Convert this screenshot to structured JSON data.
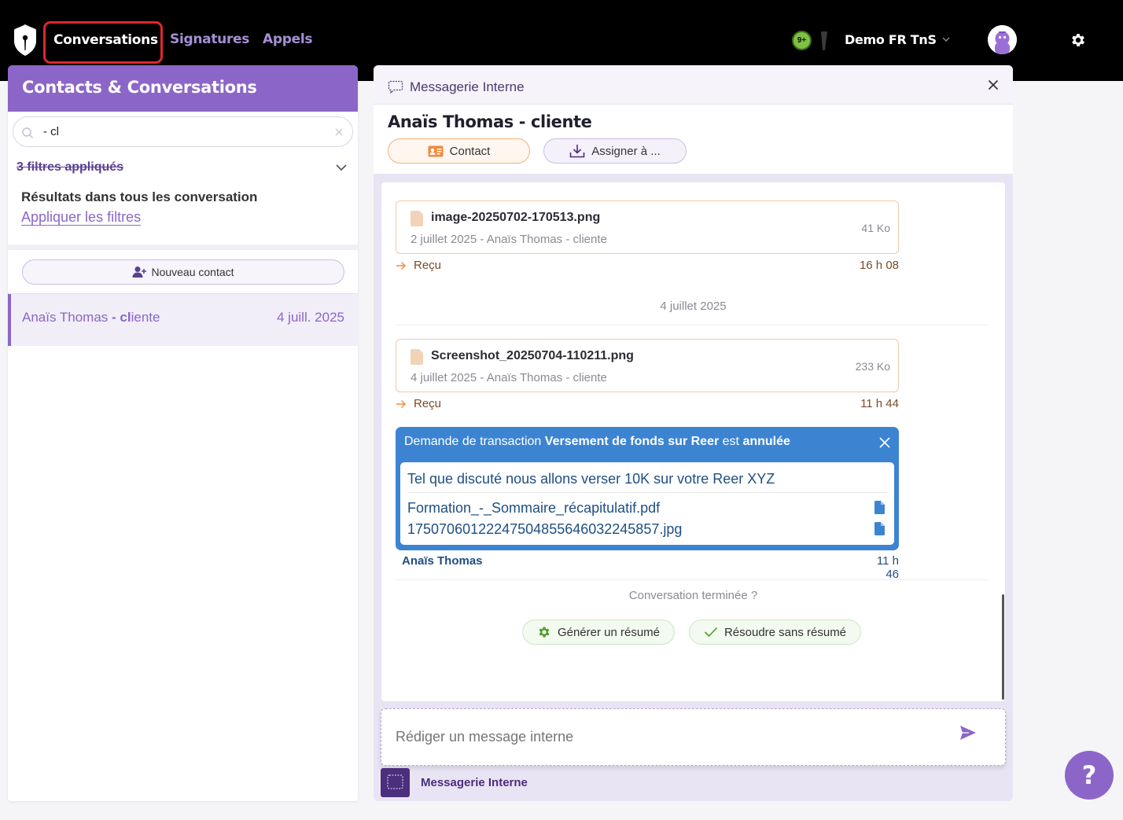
{
  "topbar": {
    "nav": {
      "conversations": "Conversations",
      "signatures": "Signatures",
      "appels": "Appels"
    },
    "notifications_badge": "9+",
    "workspace": "Demo FR TnS"
  },
  "left": {
    "header": "Contacts & Conversations",
    "search": {
      "value": "- cl"
    },
    "filters_label": "3 filtres appliqués",
    "results_title": "Résultats dans tous les conversation",
    "apply_filters": "Appliquer les filtres",
    "new_contact": "Nouveau contact",
    "conversations": [
      {
        "name_prefix": "Anaïs Thomas ",
        "name_match": "- cl",
        "name_suffix": "iente",
        "date": "4 juill. 2025"
      }
    ]
  },
  "right": {
    "top_title": "Messagerie Interne",
    "contact_name": "Anaïs Thomas - cliente",
    "buttons": {
      "contact": "Contact",
      "assign": "Assigner à ..."
    },
    "messages": [
      {
        "file_name": "image-20250702-170513.png",
        "meta": "2 juillet 2025 - Anaïs Thomas - cliente",
        "size": "41 Ko",
        "status": "Reçu",
        "time": "16 h 08"
      },
      {
        "file_name": "Screenshot_20250704-110211.png",
        "meta": "4 juillet 2025 - Anaïs Thomas - cliente",
        "size": "233 Ko",
        "status": "Reçu",
        "time": "11 h 44"
      }
    ],
    "day_separator": "4 juillet 2025",
    "transaction": {
      "prefix": "Demande de transaction ",
      "name": "Versement de fonds sur Reer",
      "middle": " est ",
      "state": "annulée",
      "message": "Tel que discuté nous allons verser 10K sur votre Reer XYZ",
      "files": [
        "Formation_-_Sommaire_récapitulatif.pdf",
        "17507060122247504855646032245857.jpg"
      ],
      "author": "Anaïs Thomas",
      "time": "11 h 46"
    },
    "ended_prompt": "Conversation terminée ?",
    "generate_summary": "Générer un résumé",
    "resolve_no_summary": "Résoudre sans résumé",
    "composer_placeholder": "Rédiger un message interne",
    "footer_label": "Messagerie Interne"
  },
  "help_label": "?",
  "colors": {
    "brand_purple": "#8b66c8",
    "accent_red": "#e1262d",
    "transaction_blue": "#3c84d2",
    "orange_accent": "#f1b17d"
  }
}
